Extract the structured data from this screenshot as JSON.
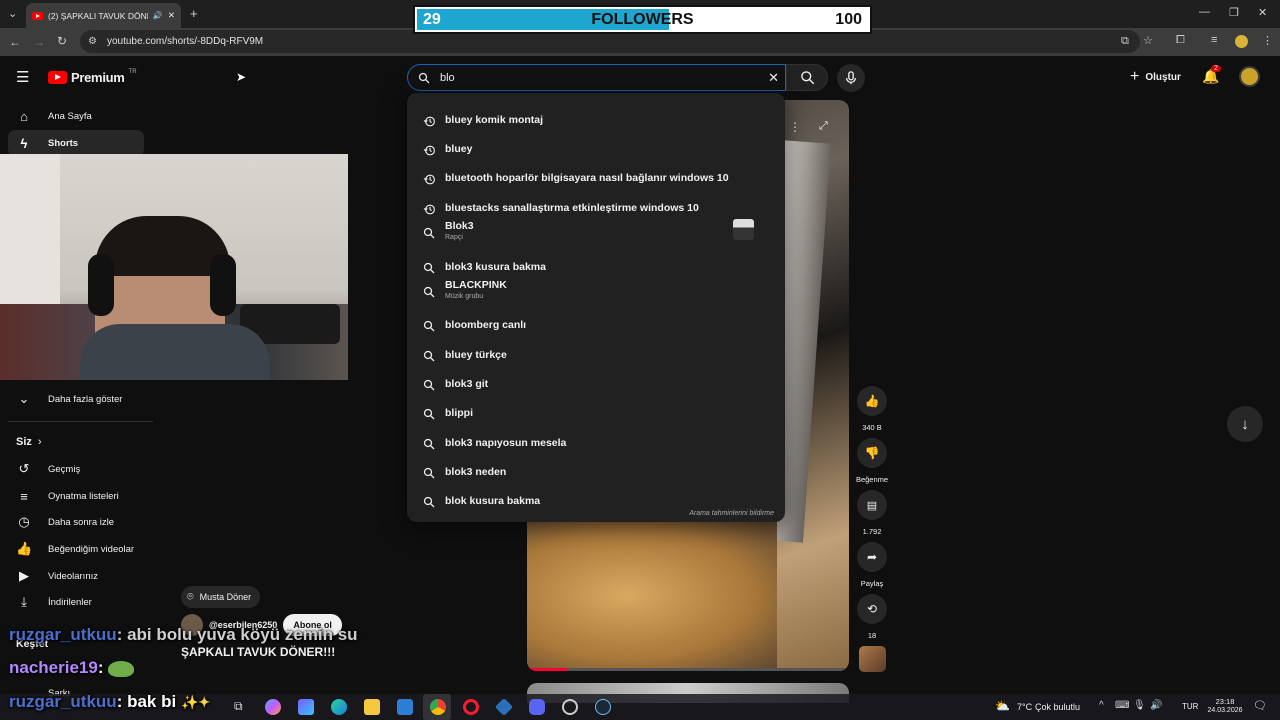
{
  "browser": {
    "tab_title": "(2) ŞAPKALI TAVUK DÖNER!!!",
    "url": "youtube.com/shorts/-8DDq-RFV9M"
  },
  "stream_overlay": {
    "followers_current": "29",
    "followers_label": "FOLLOWERS",
    "followers_goal": "100",
    "progress_fraction": 0.29
  },
  "youtube": {
    "logo": "Premium",
    "country": "TR",
    "search_value": "blo",
    "create_label": "Oluştur",
    "notif_count": "2"
  },
  "sidebar": {
    "items": [
      {
        "icon": "home-icon",
        "label": "Ana Sayfa"
      },
      {
        "icon": "shorts-icon",
        "label": "Shorts"
      }
    ],
    "show_more": "Daha fazla göster",
    "you_heading": "Siz",
    "you_items": [
      {
        "icon": "history-icon",
        "label": "Geçmiş"
      },
      {
        "icon": "playlist-icon",
        "label": "Oynatma listeleri"
      },
      {
        "icon": "clock-icon",
        "label": "Daha sonra izle"
      },
      {
        "icon": "thumbs-up-icon",
        "label": "Beğendiğim videolar"
      },
      {
        "icon": "video-icon",
        "label": "Videolarınız"
      },
      {
        "icon": "download-icon",
        "label": "İndirilenler"
      }
    ],
    "explore_heading": "Keşfet",
    "explore_partial": "Şarkı"
  },
  "suggestions": [
    {
      "type": "history",
      "text": "bluey komik montaj"
    },
    {
      "type": "history",
      "text": "bluey"
    },
    {
      "type": "history",
      "text": "bluetooth hoparlör bilgisayara nasıl bağlanır windows 10"
    },
    {
      "type": "history",
      "text": "bluestacks sanallaştırma etkinleştirme windows 10"
    },
    {
      "type": "search",
      "text": "Blok3",
      "sub": "Rapçi",
      "thumb": true
    },
    {
      "type": "search",
      "text": "blok3 kusura bakma"
    },
    {
      "type": "search",
      "text": "BLACKPINK",
      "sub": "Müzik grubu"
    },
    {
      "type": "search",
      "text": "bloomberg canlı"
    },
    {
      "type": "search",
      "text": "bluey türkçe"
    },
    {
      "type": "search",
      "text": "blok3 git"
    },
    {
      "type": "search",
      "text": "blippi"
    },
    {
      "type": "search",
      "text": "blok3 napıyosun mesela"
    },
    {
      "type": "search",
      "text": "blok3 neden"
    },
    {
      "type": "search",
      "text": "blok kusura bakma"
    }
  ],
  "suggest_report": "Arama tahminlerini bildirme",
  "short": {
    "location": "Musta Döner",
    "channel": "@eserbilen6250",
    "subscribe": "Abone ol",
    "title": "ŞAPKALI TAVUK DÖNER!!!",
    "likes": "340 B",
    "dislike_label": "Beğenme",
    "comments": "1.792",
    "share_label": "Paylaş",
    "remix_count": "18"
  },
  "chat": [
    {
      "user": "ruzgar_utkuu",
      "msg": ": abi bolu yuva köyü zemin su",
      "color": "#4a6fd1"
    },
    {
      "user": "nacherie19",
      "msg": ":",
      "color": "#b388ff"
    },
    {
      "user": "ruzgar_utkuu",
      "msg": ": bak bi",
      "color": "#4a6fd1"
    }
  ],
  "taskbar": {
    "weather": "7°C",
    "weather_text": "Çok bulutlu",
    "lang": "TUR",
    "time": "23:18",
    "date": "24.03.2026"
  }
}
